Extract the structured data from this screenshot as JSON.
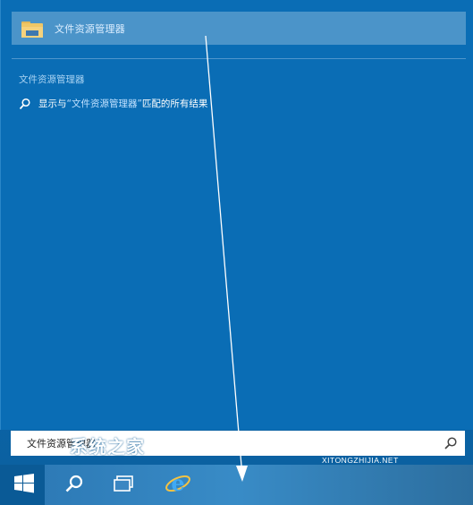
{
  "search_panel": {
    "top_result": {
      "label": "文件资源管理器",
      "icon": "folder-icon"
    },
    "section_heading": "文件资源管理器",
    "web_search": {
      "prefix": "显示与",
      "query": "“文件资源管理器”",
      "suffix": "匹配的所有结果",
      "icon": "search-icon"
    }
  },
  "search_box": {
    "value": "文件资源管理器",
    "icon": "search-icon"
  },
  "taskbar": {
    "buttons": [
      {
        "name": "start",
        "icon": "windows-logo-icon"
      },
      {
        "name": "search",
        "icon": "search-icon"
      },
      {
        "name": "task-view",
        "icon": "task-view-icon"
      },
      {
        "name": "internet-explorer",
        "icon": "ie-icon"
      }
    ]
  },
  "watermark": {
    "title": "系统之家",
    "subtitle": "XITONGZHIJIA.NET"
  },
  "colors": {
    "panel": "#0a6db5",
    "top_result_highlight": "#4b94c9",
    "taskbar": "#0a5a96",
    "accent_text": "#a8d2f2"
  }
}
